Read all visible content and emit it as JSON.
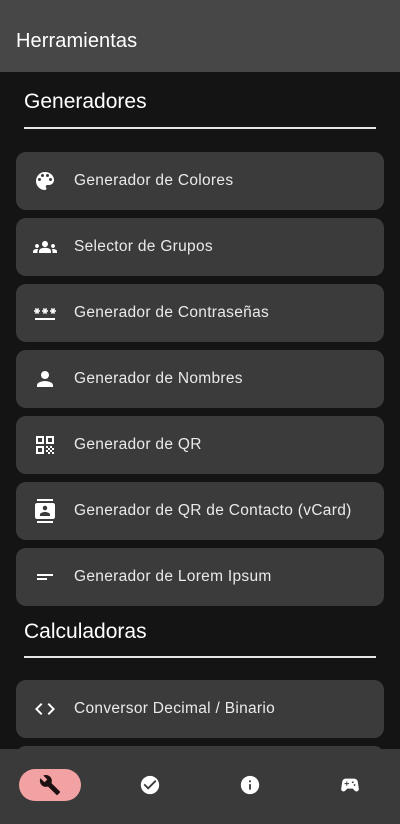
{
  "app_bar": {
    "title": "Herramientas"
  },
  "sections": [
    {
      "title": "Generadores",
      "items": [
        {
          "label": "Generador de Colores",
          "icon": "palette-icon"
        },
        {
          "label": "Selector de Grupos",
          "icon": "groups-icon"
        },
        {
          "label": "Generador de Contraseñas",
          "icon": "password-icon"
        },
        {
          "label": "Generador de Nombres",
          "icon": "person-icon"
        },
        {
          "label": "Generador de QR",
          "icon": "qr-code-icon"
        },
        {
          "label": "Generador de QR de Contacto (vCard)",
          "icon": "contact-card-icon"
        },
        {
          "label": "Generador de Lorem Ipsum",
          "icon": "short-text-icon"
        }
      ]
    },
    {
      "title": "Calculadoras",
      "items": [
        {
          "label": "Conversor Decimal / Binario",
          "icon": "code-icon"
        }
      ]
    }
  ],
  "bottom_nav": {
    "active_color": "#f2a2a2",
    "items": [
      {
        "icon": "wrench-icon",
        "active": true
      },
      {
        "icon": "check-circle-icon",
        "active": false
      },
      {
        "icon": "info-icon",
        "active": false
      },
      {
        "icon": "gamepad-icon",
        "active": false
      }
    ]
  }
}
